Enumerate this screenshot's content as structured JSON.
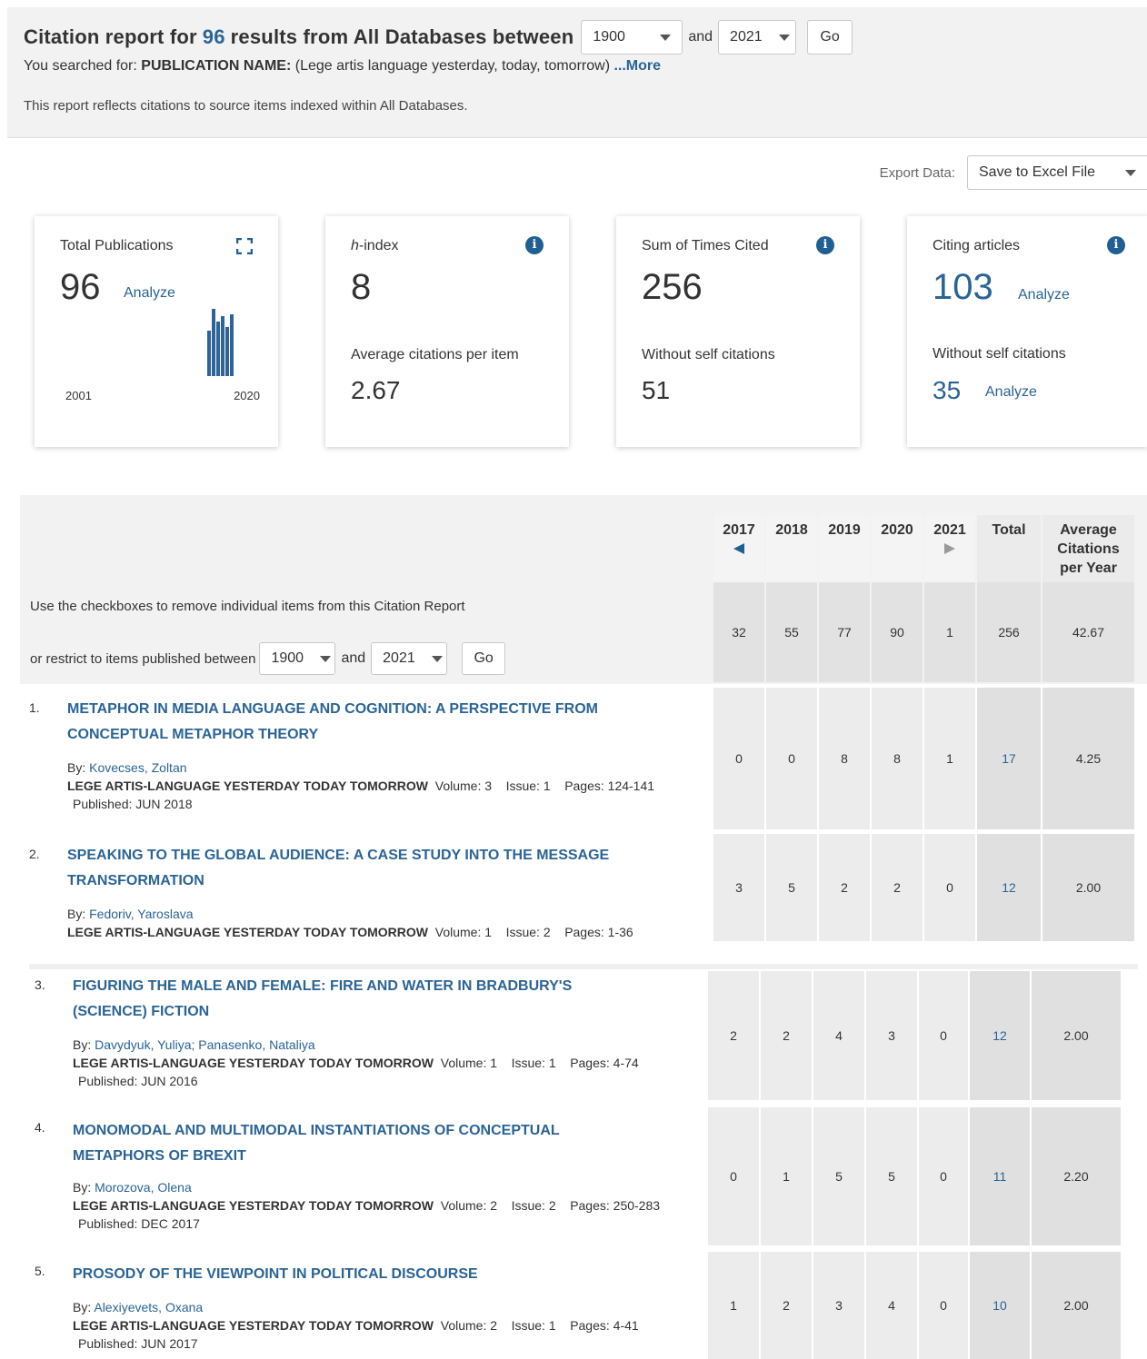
{
  "header": {
    "title_prefix": "Citation report for",
    "result_count": "96",
    "title_suffix": "results from All Databases between",
    "year_from": "1900",
    "and_label": "and",
    "year_to": "2021",
    "go_label": "Go",
    "searched_prefix": "You searched for:",
    "searched_field": "PUBLICATION NAME:",
    "searched_value": "(Lege artis language yesterday, today, tomorrow)",
    "more_label": "...More",
    "reflect_text": "This report reflects citations to source items indexed within All Databases."
  },
  "export": {
    "label": "Export Data:",
    "selected": "Save to Excel File"
  },
  "cards": {
    "total_pubs": {
      "title": "Total Publications",
      "value": "96",
      "analyze": "Analyze",
      "year_start": "2001",
      "year_end": "2020"
    },
    "h_index": {
      "title_italic": "h",
      "title_rest": "-index",
      "value": "8",
      "sub_label": "Average citations per item",
      "sub_value": "2.67"
    },
    "times_cited": {
      "title": "Sum of Times Cited",
      "value": "256",
      "sub_label": "Without self citations",
      "sub_value": "51"
    },
    "citing": {
      "title": "Citing articles",
      "value": "103",
      "analyze": "Analyze",
      "sub_label": "Without self citations",
      "sub_value": "35",
      "sub_analyze": "Analyze"
    }
  },
  "table": {
    "use_text": "Use the checkboxes to remove individual items from this Citation Report",
    "restrict_label": "or restrict to items published between",
    "year_from": "1900",
    "and_label": "and",
    "year_to": "2021",
    "go_label": "Go",
    "columns": [
      "2017",
      "2018",
      "2019",
      "2020",
      "2021",
      "Total"
    ],
    "avg_col": [
      "Average",
      "Citations",
      "per Year"
    ],
    "totals": [
      "32",
      "55",
      "77",
      "90",
      "1",
      "256",
      "42.67"
    ]
  },
  "items": [
    {
      "num": "1.",
      "title": "METAPHOR IN MEDIA LANGUAGE AND COGNITION: A PERSPECTIVE FROM CONCEPTUAL METAPHOR THEORY",
      "by_label": "By:",
      "authors": "Kovecses, Zoltan",
      "source": "LEGE ARTIS-LANGUAGE YESTERDAY TODAY TOMORROW",
      "volume": "Volume: 3",
      "issue": "Issue: 1",
      "pages": "Pages: 124-141",
      "published": "Published:  JUN 2018",
      "counts": [
        "0",
        "0",
        "8",
        "8",
        "1",
        "17",
        "4.25"
      ]
    },
    {
      "num": "2.",
      "title": "SPEAKING TO THE GLOBAL AUDIENCE: A CASE STUDY INTO THE MESSAGE TRANSFORMATION",
      "by_label": "By:",
      "authors": "Fedoriv, Yaroslava",
      "source": "LEGE ARTIS-LANGUAGE YESTERDAY TODAY TOMORROW",
      "volume": "Volume: 1",
      "issue": "Issue: 2",
      "pages": "Pages: 1-36",
      "published": "",
      "counts": [
        "3",
        "5",
        "2",
        "2",
        "0",
        "12",
        "2.00"
      ]
    },
    {
      "num": "3.",
      "title": "FIGURING THE MALE AND FEMALE: FIRE AND WATER IN BRADBURY'S (SCIENCE) FICTION",
      "by_label": "By:",
      "authors": "Davydyuk, Yuliya; Panasenko, Nataliya",
      "source": "LEGE ARTIS-LANGUAGE YESTERDAY TODAY TOMORROW",
      "volume": "Volume: 1",
      "issue": "Issue: 1",
      "pages": "Pages: 4-74",
      "published": "Published:  JUN 2016",
      "counts": [
        "2",
        "2",
        "4",
        "3",
        "0",
        "12",
        "2.00"
      ]
    },
    {
      "num": "4.",
      "title": "MONOMODAL AND MULTIMODAL INSTANTIATIONS OF CONCEPTUAL METAPHORS OF BREXIT",
      "by_label": "By:",
      "authors": "Morozova, Olena",
      "source": "LEGE ARTIS-LANGUAGE YESTERDAY TODAY TOMORROW",
      "volume": "Volume: 2",
      "issue": "Issue: 2",
      "pages": "Pages: 250-283",
      "published": "Published:  DEC 2017",
      "counts": [
        "0",
        "1",
        "5",
        "5",
        "0",
        "11",
        "2.20"
      ]
    },
    {
      "num": "5.",
      "title": "PROSODY OF THE VIEWPOINT IN POLITICAL DISCOURSE",
      "by_label": "By:",
      "authors": "Alexiyevets, Oxana",
      "source": "LEGE ARTIS-LANGUAGE YESTERDAY TODAY TOMORROW",
      "volume": "Volume: 2",
      "issue": "Issue: 1",
      "pages": "Pages: 4-41",
      "published": "Published:  JUN 2017",
      "counts": [
        "1",
        "2",
        "3",
        "4",
        "0",
        "10",
        "2.00"
      ]
    }
  ]
}
